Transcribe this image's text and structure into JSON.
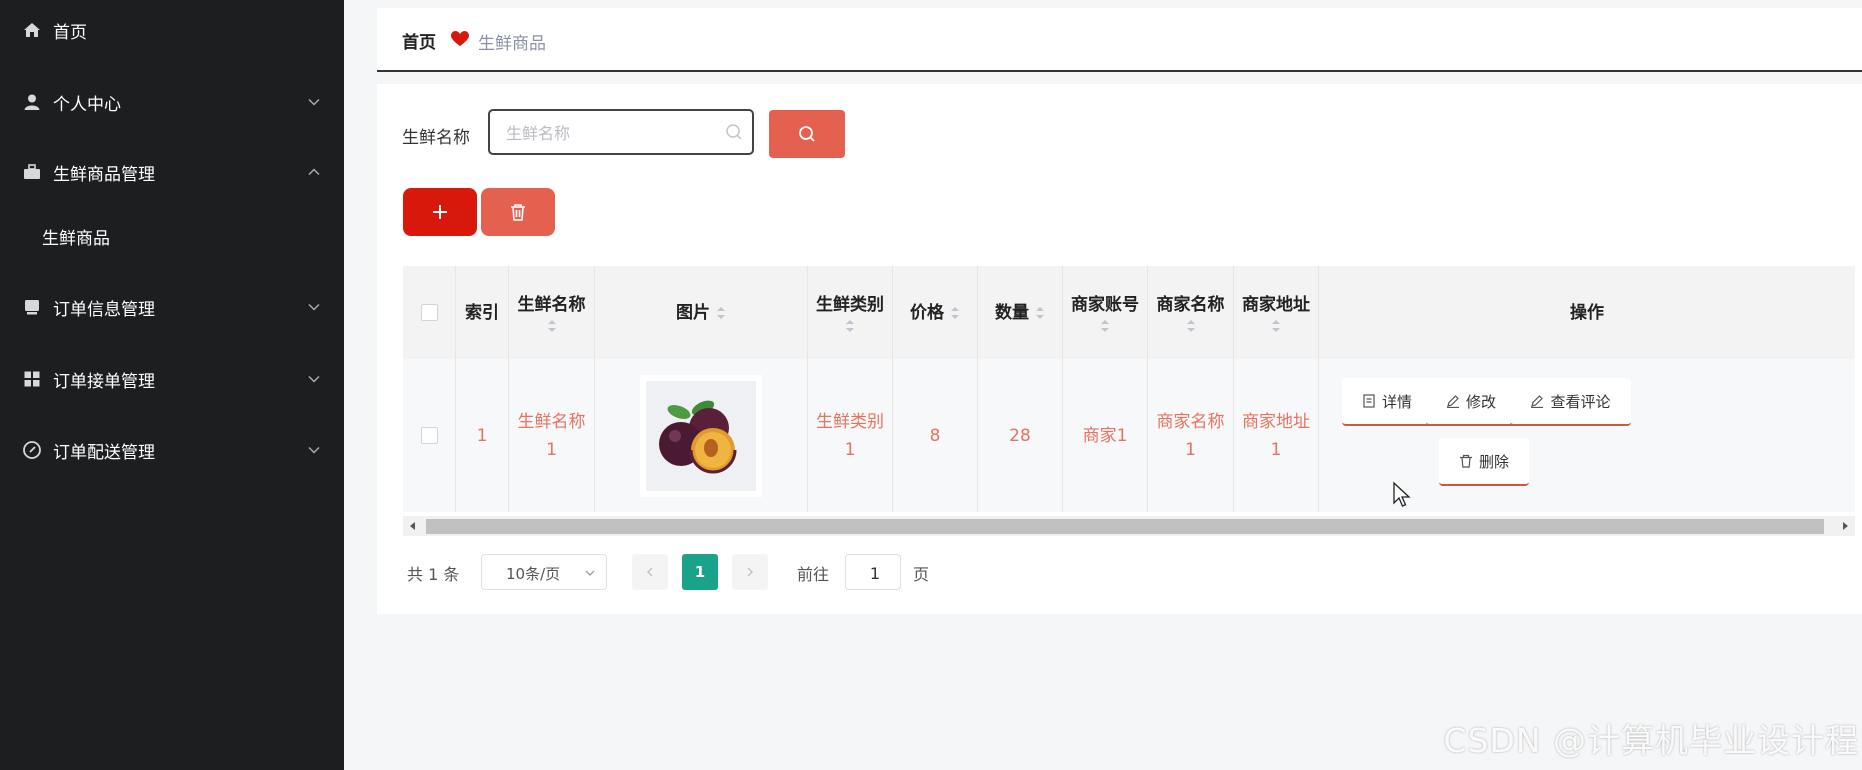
{
  "sidebar": {
    "items": [
      {
        "label": "首页",
        "icon": "home-icon"
      },
      {
        "label": "个人中心",
        "icon": "user-icon",
        "chevron": "down"
      },
      {
        "label": "生鲜商品管理",
        "icon": "briefcase-icon",
        "chevron": "up"
      },
      {
        "label": "生鲜商品",
        "sub": true
      },
      {
        "label": "订单信息管理",
        "icon": "inbox-icon",
        "chevron": "down"
      },
      {
        "label": "订单接单管理",
        "icon": "grid-icon",
        "chevron": "down"
      },
      {
        "label": "订单配送管理",
        "icon": "compass-icon",
        "chevron": "down"
      }
    ]
  },
  "breadcrumb": {
    "home": "首页",
    "current": "生鲜商品",
    "separator_icon": "heart-icon"
  },
  "search": {
    "label": "生鲜名称",
    "placeholder": "生鲜名称",
    "value": ""
  },
  "table": {
    "columns": [
      "索引",
      "生鲜名称",
      "图片",
      "生鲜类别",
      "价格",
      "数量",
      "商家账号",
      "商家名称",
      "商家地址",
      "操作"
    ],
    "rows": [
      {
        "index": "1",
        "name": [
          "生鲜名称",
          "1"
        ],
        "image": "plum-image",
        "category": [
          "生鲜类别",
          "1"
        ],
        "price": "8",
        "quantity": "28",
        "merchant_account": "商家1",
        "merchant_name": [
          "商家名称",
          "1"
        ],
        "merchant_address": [
          "商家地址",
          "1"
        ]
      }
    ],
    "actions": {
      "detail": "详情",
      "edit": "修改",
      "reviews": "查看评论",
      "delete": "删除"
    }
  },
  "pagination": {
    "total": "共 1 条",
    "page_size": "10条/页",
    "current_page": "1",
    "goto_label": "前往",
    "goto_value": "1",
    "goto_suffix": "页"
  },
  "watermark": "CSDN @计算机毕业设计程",
  "colors": {
    "sidebar_bg": "#1d1e20",
    "accent_red": "#d9180c",
    "accent_coral": "#e4614f",
    "link_text": "#e5735f",
    "pager_active": "#1aa38a"
  }
}
